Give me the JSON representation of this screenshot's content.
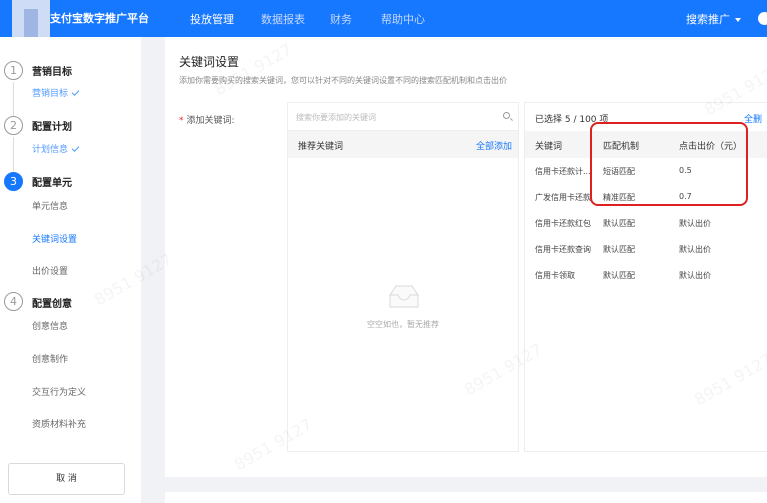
{
  "app": {
    "brand": "支付宝数字推广平台"
  },
  "nav": {
    "items": [
      {
        "label": "投放管理",
        "active": true
      },
      {
        "label": "数据报表",
        "active": false
      },
      {
        "label": "财务",
        "active": false
      },
      {
        "label": "帮助中心",
        "active": false
      }
    ],
    "account": "搜索推广"
  },
  "sidebar": {
    "steps": [
      {
        "number": "1",
        "title": "营销目标",
        "sub": "营销目标"
      },
      {
        "number": "2",
        "title": "配置计划",
        "sub": "计划信息"
      },
      {
        "number": "3",
        "title": "配置单元"
      },
      {
        "number": "4",
        "title": "配置创意"
      }
    ],
    "unit_items": [
      "单元信息",
      "关键词设置",
      "出价设置"
    ],
    "creative_items": [
      "创意信息",
      "创意制作",
      "交互行为定义",
      "资质材料补充"
    ],
    "cancel_label": "取 消"
  },
  "main": {
    "title": "关键词设置",
    "description": "添加你需要购买的搜索关键词，您可以针对不同的关键词设置不同的搜索匹配机制和点击出价",
    "field_label": "添加关键词:",
    "required_mark": "*",
    "search_placeholder": "搜索你要添加的关键词",
    "recommend_title": "推荐关键词",
    "add_all": "全部添加",
    "empty_text": "空空如也，暂无推荐",
    "selected_title": "已选择 5 / 100 项",
    "clear_all": "全删",
    "table": {
      "headers": [
        "关键词",
        "匹配机制",
        "点击出价（元）"
      ],
      "rows": [
        [
          "信用卡还款计...",
          "短语匹配",
          "0.5"
        ],
        [
          "广发信用卡还款",
          "精准匹配",
          "0.7"
        ],
        [
          "信用卡还款红包",
          "默认匹配",
          "默认出价"
        ],
        [
          "信用卡还款查询",
          "默认匹配",
          "默认出价"
        ],
        [
          "信用卡领取",
          "默认匹配",
          "默认出价"
        ]
      ]
    }
  },
  "watermark": "8951 9127",
  "colors": {
    "primary": "#1677ff",
    "highlight": "#e02020"
  }
}
